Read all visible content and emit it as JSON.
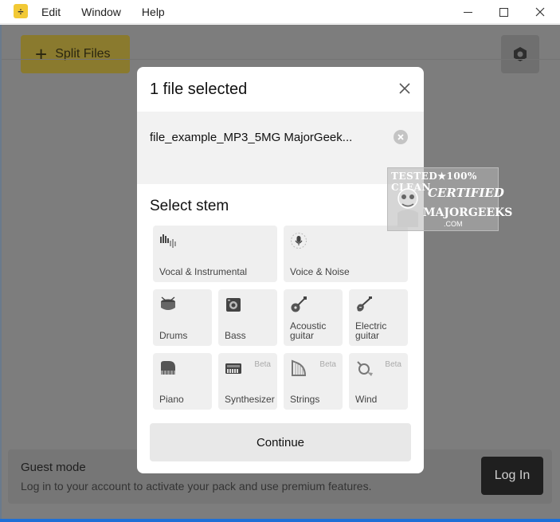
{
  "window": {
    "menu": [
      "Edit",
      "Window",
      "Help"
    ]
  },
  "app": {
    "split_label": "Split Files",
    "guest_title": "Guest mode",
    "guest_sub": "Log in to your account to activate your pack and use premium features.",
    "login_label": "Log In"
  },
  "modal": {
    "title": "1 file selected",
    "file_name": "file_example_MP3_5MG MajorGeek...",
    "stem_title": "Select stem",
    "continue_label": "Continue",
    "stems": [
      {
        "label": "Vocal & Instrumental",
        "icon": "vocal-instrumental-icon"
      },
      {
        "label": "Voice & Noise",
        "icon": "voice-noise-icon"
      },
      {
        "label": "Drums",
        "icon": "drum-icon"
      },
      {
        "label": "Bass",
        "icon": "bass-icon"
      },
      {
        "label": "Acoustic guitar",
        "icon": "acoustic-guitar-icon"
      },
      {
        "label": "Electric guitar",
        "icon": "electric-guitar-icon"
      },
      {
        "label": "Piano",
        "icon": "piano-icon"
      },
      {
        "label": "Synthesizer",
        "icon": "synthesizer-icon",
        "beta": "Beta"
      },
      {
        "label": "Strings",
        "icon": "harp-icon",
        "beta": "Beta"
      },
      {
        "label": "Wind",
        "icon": "horn-icon",
        "beta": "Beta"
      }
    ]
  },
  "watermark": {
    "line1": "TESTED★100% CLEAN",
    "line2": "CERTIFIED",
    "line3": "MAJORGEEKS",
    "line4": ".COM"
  },
  "colors": {
    "accent": "#f2c935",
    "overlay": "#7d7d7d",
    "tile": "#efefef"
  }
}
